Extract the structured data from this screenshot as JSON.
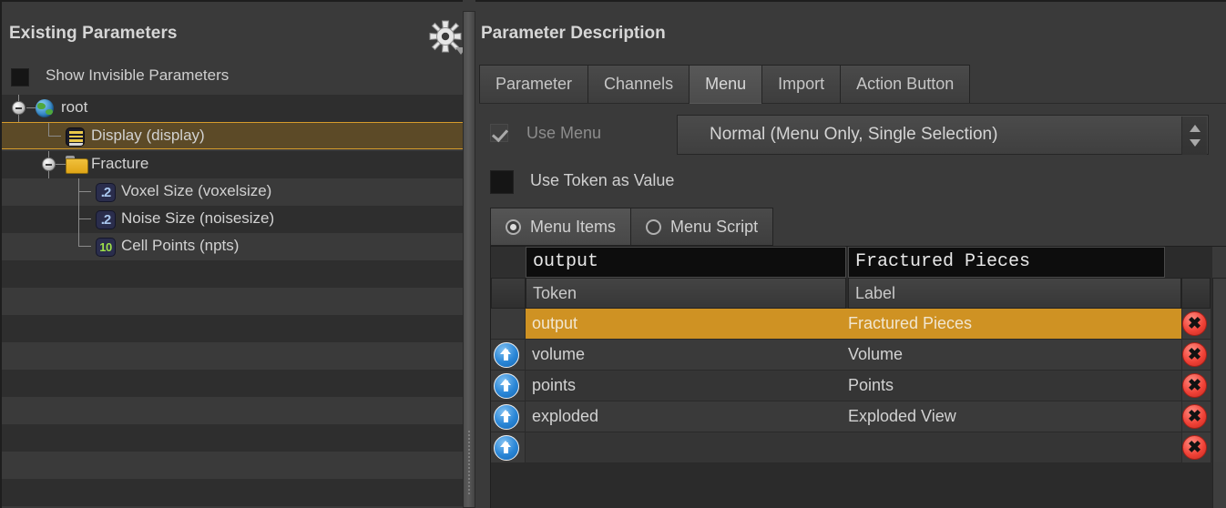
{
  "left_panel": {
    "title": "Existing Parameters",
    "gear_icon": "gear-icon",
    "show_invisible": {
      "label": "Show Invisible Parameters",
      "checked": false
    },
    "tree": [
      {
        "label": "root",
        "icon": "globe-icon",
        "depth": 0,
        "expander": "collapse",
        "selected": false
      },
      {
        "label": "Display (display)",
        "icon": "menu-list-icon",
        "depth": 1,
        "expander": "none",
        "selected": true
      },
      {
        "label": "Fracture",
        "icon": "folder-icon",
        "depth": 1,
        "expander": "collapse",
        "selected": false
      },
      {
        "label": "Voxel Size (voxelsize)",
        "icon": "float-icon",
        "depth": 2,
        "expander": "none",
        "selected": false
      },
      {
        "label": "Noise Size (noisesize)",
        "icon": "float-icon",
        "depth": 2,
        "expander": "none",
        "selected": false
      },
      {
        "label": "Cell Points (npts)",
        "icon": "int-icon",
        "depth": 2,
        "expander": "none",
        "selected": false
      }
    ],
    "icon_glyphs": {
      "float": ".2",
      "int": "10"
    },
    "empty_rows": 9
  },
  "right_panel": {
    "title": "Parameter Description",
    "tabs": [
      {
        "label": "Parameter",
        "active": false
      },
      {
        "label": "Channels",
        "active": false
      },
      {
        "label": "Menu",
        "active": true
      },
      {
        "label": "Import",
        "active": false
      },
      {
        "label": "Action Button",
        "active": false
      }
    ],
    "use_menu": {
      "label": "Use Menu",
      "checked": true,
      "mode_value": "Normal (Menu Only, Single Selection)"
    },
    "use_token_as_value": {
      "label": "Use Token as Value",
      "checked": false
    },
    "menu_source": [
      {
        "label": "Menu Items",
        "selected": true
      },
      {
        "label": "Menu Script",
        "selected": false
      }
    ],
    "edit_fields": {
      "token": "output",
      "label": "Fractured Pieces"
    },
    "table": {
      "headers": {
        "token": "Token",
        "label": "Label",
        "pad": ""
      },
      "rows": [
        {
          "token": "output",
          "label": "Fractured Pieces",
          "selected": true,
          "has_move_up": false,
          "has_delete": true
        },
        {
          "token": "volume",
          "label": "Volume",
          "selected": false,
          "has_move_up": true,
          "has_delete": true
        },
        {
          "token": "points",
          "label": "Points",
          "selected": false,
          "has_move_up": true,
          "has_delete": true
        },
        {
          "token": "exploded",
          "label": "Exploded View",
          "selected": false,
          "has_move_up": true,
          "has_delete": true
        },
        {
          "token": "",
          "label": "",
          "selected": false,
          "has_move_up": true,
          "has_delete": true
        }
      ],
      "delete_glyph": "✖",
      "move_up_icon": "arrow-up-icon"
    }
  },
  "colors": {
    "background": "#3a3a3a",
    "panel_dark": "#2e2e2e",
    "selection_orange": "#cf9223",
    "tree_selection": "#5c4a27",
    "tree_selection_border": "#d79c2b",
    "text": "#d2d2d2",
    "text_dim": "#8c8c8c",
    "delete_red": "#ef4136",
    "move_up_blue": "#2a86d6",
    "folder_yellow": "#e0a516",
    "int_green": "#9ee04a",
    "float_blue": "#a9c7ef"
  }
}
